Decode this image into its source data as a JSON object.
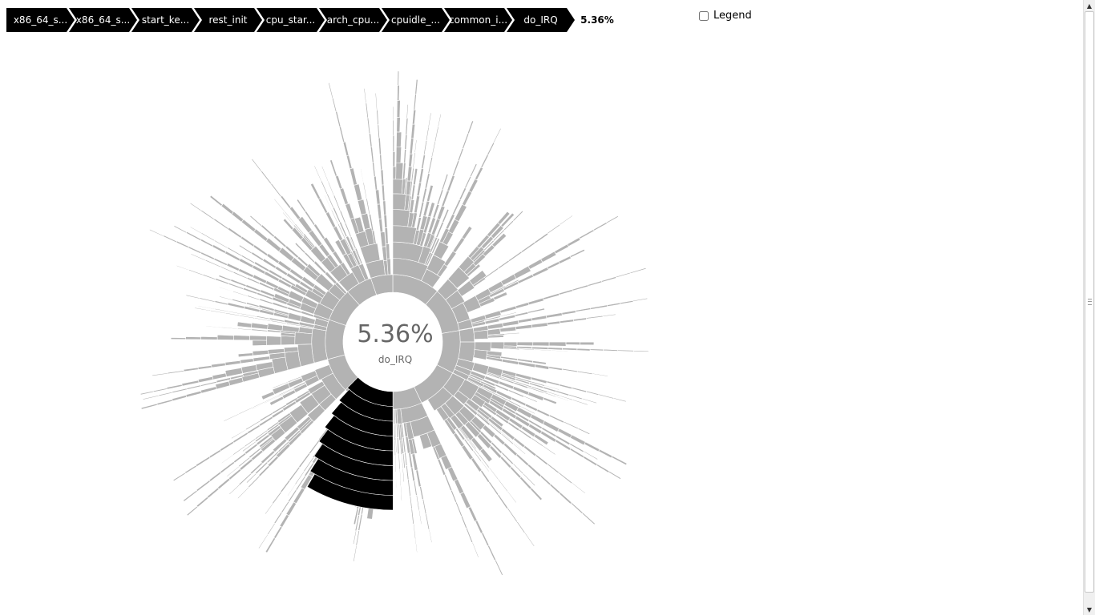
{
  "breadcrumb": {
    "items": [
      {
        "label": "x86_64_s..."
      },
      {
        "label": "x86_64_s..."
      },
      {
        "label": "start_ke..."
      },
      {
        "label": "rest_init"
      },
      {
        "label": "cpu_star..."
      },
      {
        "label": "arch_cpu..."
      },
      {
        "label": "cpuidle_..."
      },
      {
        "label": "common_i..."
      },
      {
        "label": "do_IRQ"
      }
    ],
    "percentage": "5.36%"
  },
  "legend": {
    "label": "Legend",
    "checked": false
  },
  "center": {
    "percentage": "5.36%",
    "name": "do_IRQ"
  },
  "chart_data": {
    "type": "sunburst",
    "highlighted_path": [
      "x86_64_s...",
      "x86_64_s...",
      "start_ke...",
      "rest_init",
      "cpu_star...",
      "arch_cpu...",
      "cpuidle_...",
      "common_i...",
      "do_IRQ"
    ],
    "highlighted_percentage": 5.36,
    "colors": {
      "highlight": "#000000",
      "segment": "#b3b3b3",
      "separator": "#ffffff"
    }
  }
}
